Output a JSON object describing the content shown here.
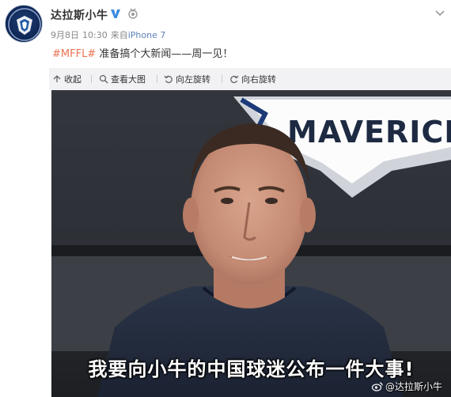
{
  "post": {
    "user_name": "达拉斯小牛",
    "verified_icon": "verified-v-icon",
    "date": "9月8日",
    "time": "10:30",
    "source_prefix": "来自",
    "source": "iPhone 7",
    "hashtag": "#MFFL#",
    "text": "准备搞个大新闻——周一见！",
    "colors": {
      "hashtag": "#eb7350",
      "source": "#5b7fb7",
      "verified": "#3b8be3"
    }
  },
  "toolbar": {
    "collapse_label": "收起",
    "view_large_label": "查看大图",
    "rotate_left_label": "向左旋转",
    "rotate_right_label": "向右旋转"
  },
  "media": {
    "subtitle": "我要向小牛的中国球迷公布一件大事!",
    "watermark": "@达拉斯小牛",
    "background_logo_text": "MAVERICKS"
  }
}
